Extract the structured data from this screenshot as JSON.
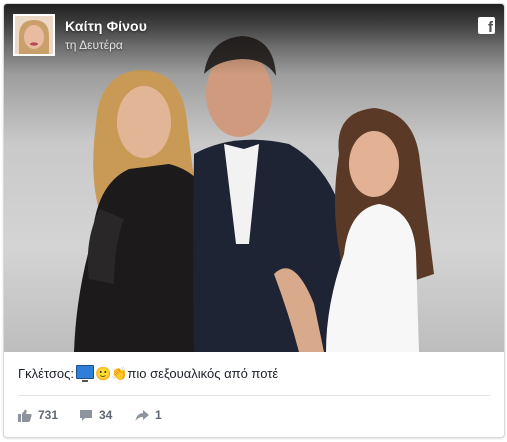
{
  "post": {
    "author": "Καίτη Φίνου",
    "time": "τη Δευτέρα",
    "caption_prefix": "Γκλέτσος:",
    "caption_emojis": "🙂👏",
    "caption_text": "πιο σεξουαλικός από ποτέ"
  },
  "stats": {
    "likes": "731",
    "comments": "34",
    "shares": "1"
  },
  "icons": {
    "brand": "facebook-icon",
    "like": "thumbs-up-icon",
    "comment": "comment-icon",
    "share": "share-arrow-icon"
  },
  "colors": {
    "accent": "#606770",
    "text": "#1d2129"
  }
}
